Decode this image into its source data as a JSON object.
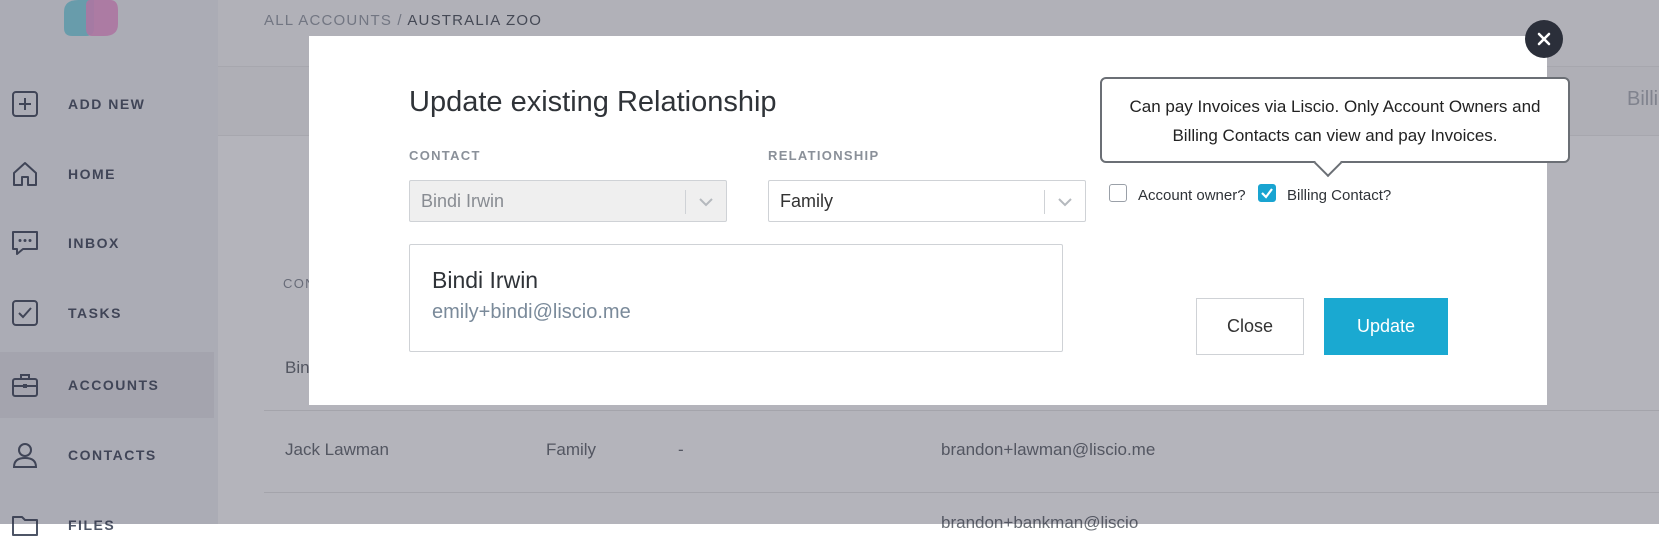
{
  "sidebar": {
    "items": [
      {
        "label": "ADD NEW",
        "icon": "plus-square-icon"
      },
      {
        "label": "HOME",
        "icon": "home-icon"
      },
      {
        "label": "INBOX",
        "icon": "message-icon"
      },
      {
        "label": "TASKS",
        "icon": "checkbox-icon"
      },
      {
        "label": "ACCOUNTS",
        "icon": "briefcase-icon"
      },
      {
        "label": "CONTACTS",
        "icon": "user-icon"
      },
      {
        "label": "FILES",
        "icon": "folder-icon"
      }
    ]
  },
  "breadcrumb": {
    "root": "ALL ACCOUNTS",
    "separator": " / ",
    "current": "AUSTRALIA ZOO"
  },
  "background": {
    "billing_header": "Billing",
    "column_header": "CON",
    "rows": [
      {
        "name": "Bin",
        "relationship": "",
        "phone": "",
        "email": ""
      },
      {
        "name": "Jack Lawman",
        "relationship": "Family",
        "phone": "-",
        "email": "brandon+lawman@liscio.me"
      },
      {
        "name": "",
        "relationship": "",
        "phone": "",
        "email": "brandon+bankman@liscio"
      }
    ]
  },
  "modal": {
    "title": "Update existing Relationship",
    "contact_label": "CONTACT",
    "contact_value": "Bindi Irwin",
    "relationship_label": "RELATIONSHIP",
    "relationship_value": "Family",
    "card": {
      "name": "Bindi Irwin",
      "email": "emily+bindi@liscio.me"
    },
    "account_owner_label": "Account owner?",
    "account_owner_checked": false,
    "billing_contact_label": "Billing Contact?",
    "billing_contact_checked": true,
    "close_label": "Close",
    "update_label": "Update",
    "tooltip": "Can pay Invoices via Liscio. Only Account Owners and Billing Contacts can view and pay Invoices."
  },
  "colors": {
    "accent": "#1aa9d1",
    "sidebar_text": "#4d5566",
    "close_circle": "#2b2f3a"
  }
}
